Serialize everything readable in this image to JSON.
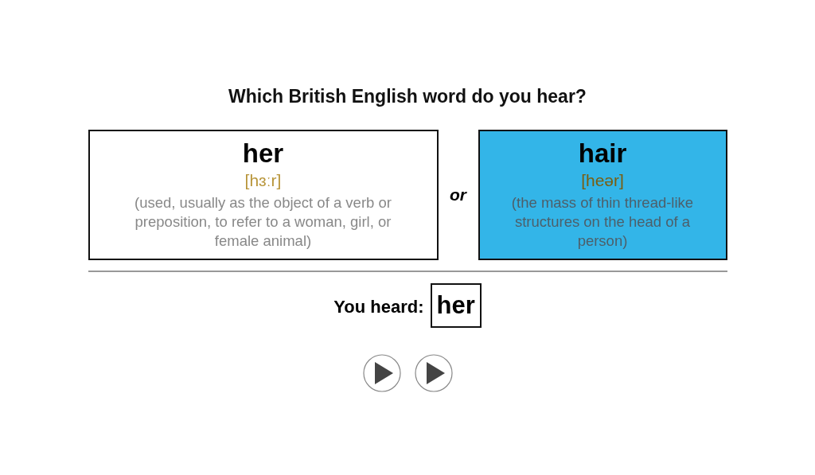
{
  "question": "Which British English word do you hear?",
  "options": [
    {
      "word": "her",
      "phonetic": "[hɜːr]",
      "definition": "(used, usually as the object of a verb or preposition, to refer to a woman, girl, or female animal)",
      "selected": false
    },
    {
      "word": "hair",
      "phonetic": "[heər]",
      "definition": "(the mass of thin thread-like structures on the head of a person)",
      "selected": true
    }
  ],
  "separator": "or",
  "result": {
    "label": "You heard:",
    "answer": "her"
  },
  "play_buttons": [
    {
      "kind": "play"
    },
    {
      "kind": "play"
    }
  ]
}
